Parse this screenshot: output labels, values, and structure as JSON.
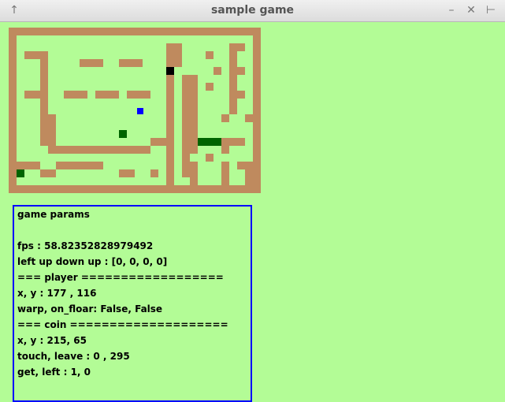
{
  "window": {
    "title": "sample game",
    "pin_icon": "↑",
    "minimize_icon": "–",
    "close_icon": "✕",
    "maximize_icon": "⊢"
  },
  "colors": {
    "background": "#b3fc96",
    "wall": "#bf8a5e",
    "player": "#0000ff",
    "coin": "#006400",
    "enemy": "#000000",
    "panel_border": "#0000ff"
  },
  "params": {
    "heading": "game params",
    "fps": "fps : 58.82352828979492",
    "keys": "left up down up : [0, 0, 0, 0]",
    "player_header": "=== player ==================",
    "player_xy": "x, y : 177 , 116",
    "warp": "warp, on_floar: False, False",
    "coin_header": "=== coin ====================",
    "coin_xy": "x, y : 215, 65",
    "touch": "touch, leave : 0 , 295",
    "get_left": "get, left : 1, 0"
  }
}
